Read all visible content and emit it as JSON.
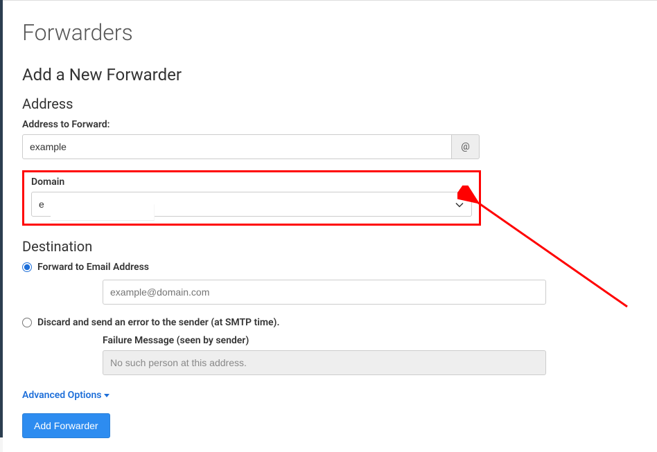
{
  "page": {
    "title": "Forwarders",
    "section_title": "Add a New Forwarder"
  },
  "address": {
    "heading": "Address",
    "to_forward_label": "Address to Forward:",
    "to_forward_value": "example",
    "at_symbol": "@",
    "domain_label": "Domain",
    "domain_value": "e"
  },
  "destination": {
    "heading": "Destination",
    "forward_radio_label": "Forward to Email Address",
    "forward_email_placeholder": "example@domain.com",
    "discard_radio_label": "Discard and send an error to the sender (at SMTP time).",
    "failure_label": "Failure Message (seen by sender)",
    "failure_value": "No such person at this address."
  },
  "advanced": {
    "label": "Advanced Options"
  },
  "actions": {
    "add_button": "Add Forwarder"
  }
}
